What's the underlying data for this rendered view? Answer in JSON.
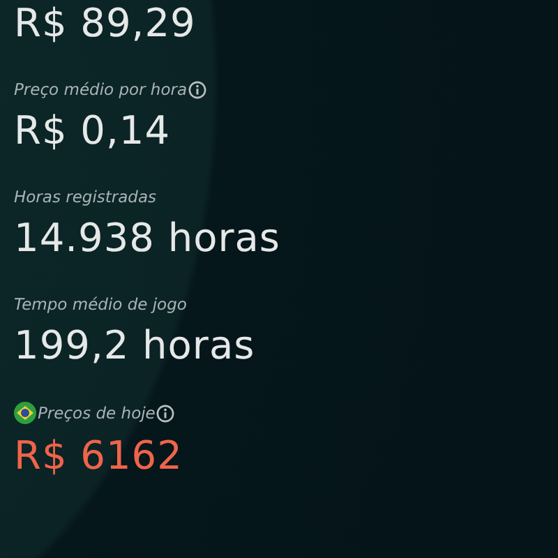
{
  "stats": [
    {
      "kind": "total",
      "value": "R$ 89,29"
    },
    {
      "kind": "plain",
      "label": "Preço médio por hora",
      "info": true,
      "value": "R$ 0,14"
    },
    {
      "kind": "plain",
      "label": "Horas registradas",
      "info": false,
      "value": "14.938 horas"
    },
    {
      "kind": "plain",
      "label": "Tempo médio de jogo",
      "info": false,
      "value": "199,2 horas"
    },
    {
      "kind": "today",
      "label": "Preços de hoje",
      "info": true,
      "value": "R$ 6162"
    }
  ]
}
